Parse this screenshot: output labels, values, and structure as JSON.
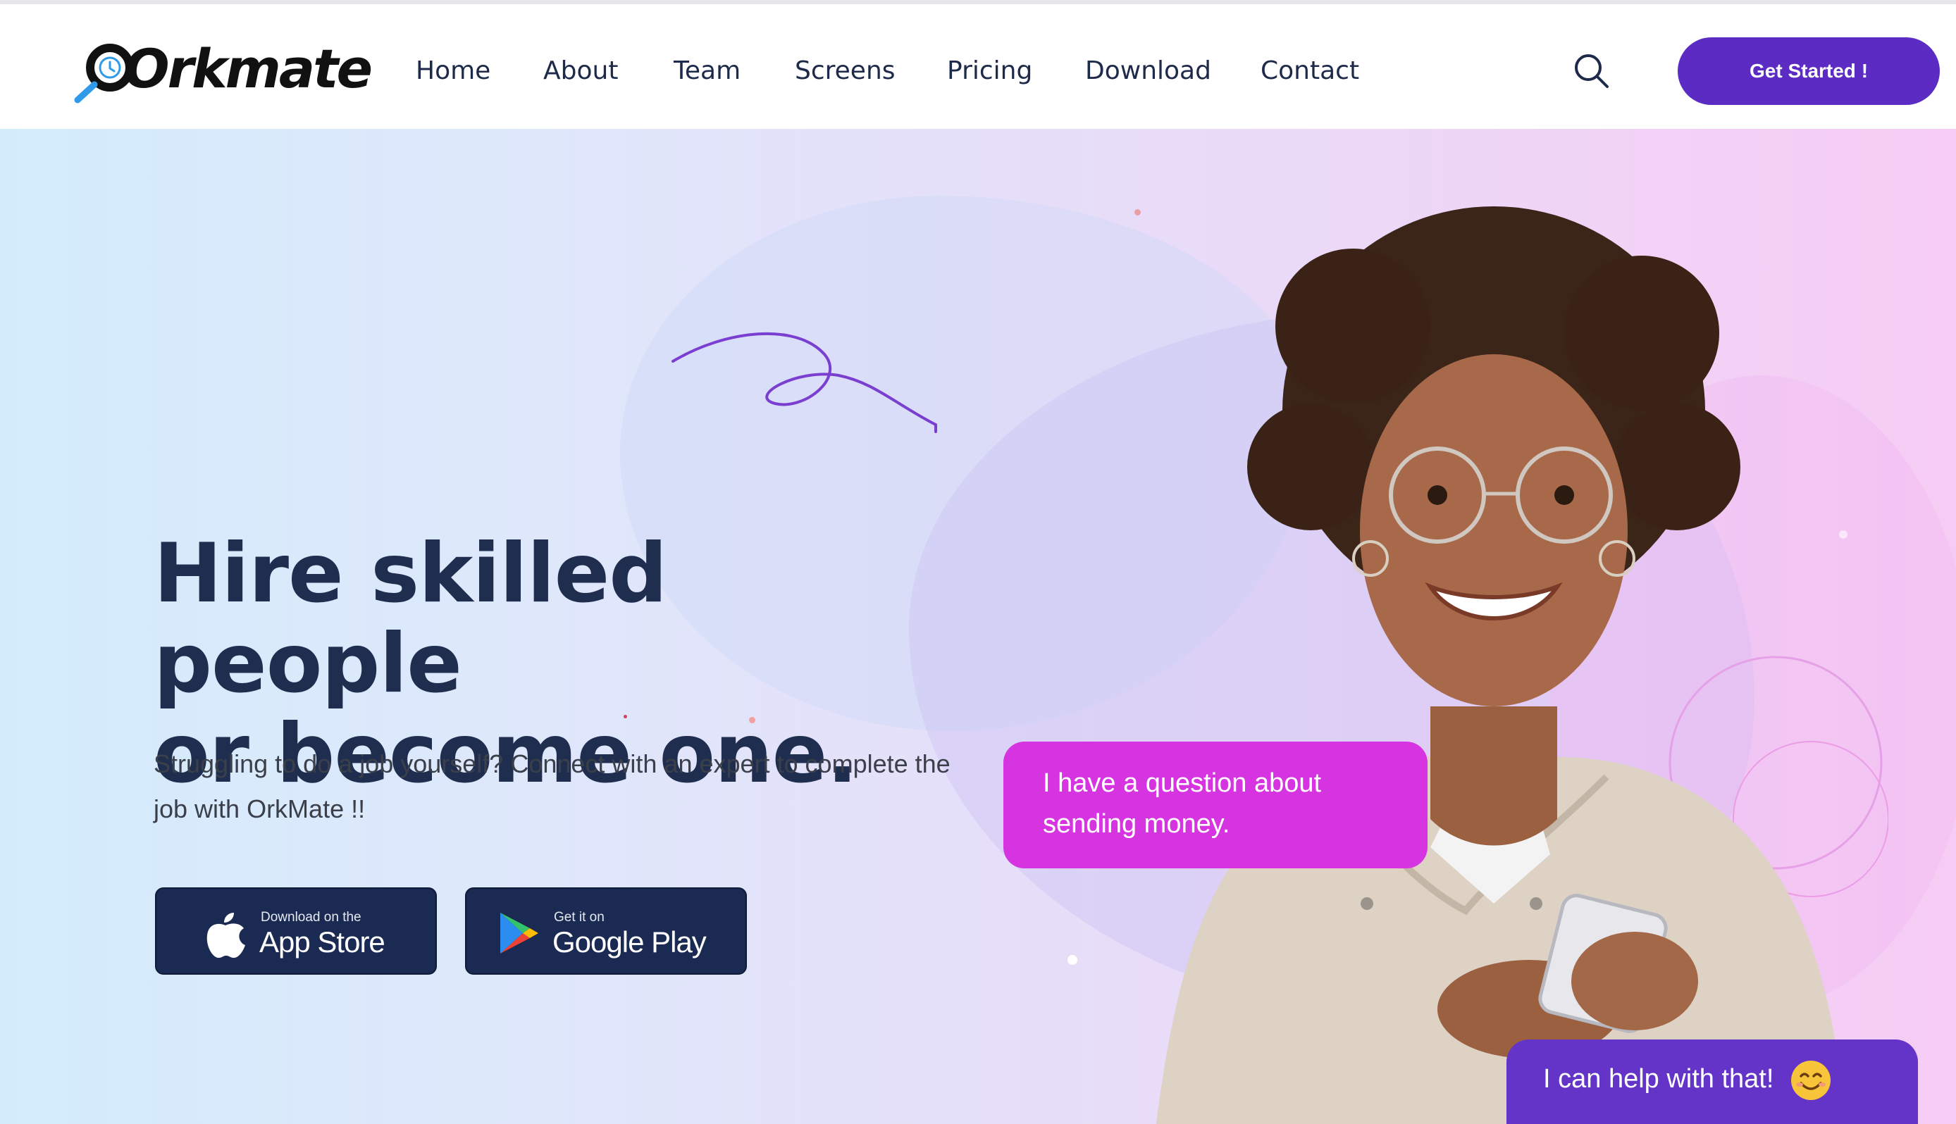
{
  "brand": {
    "logo_text": "Orkmate",
    "accent_color": "#5b2bc4"
  },
  "nav": {
    "items": [
      {
        "label": "Home"
      },
      {
        "label": "About"
      },
      {
        "label": "Team"
      },
      {
        "label": "Screens"
      },
      {
        "label": "Pricing"
      },
      {
        "label": "Download"
      },
      {
        "label": "Contact"
      }
    ],
    "search_icon": "search-icon",
    "cta_label": "Get Started !"
  },
  "hero": {
    "headline_line1": "Hire skilled people",
    "headline_line2": "or become one.",
    "subtext": "Struggling to do a job yourself? Connect with an expert to complete the job with OrkMate !!",
    "app_store": {
      "small": "Download on the",
      "big": "App Store",
      "icon": "apple-icon"
    },
    "google_play": {
      "small": "Get it on",
      "big": "Google Play",
      "icon": "google-play-icon"
    },
    "chat_question": "I have a question about sending money.",
    "chat_answer": "I can help with that!",
    "answer_emoji": "smiling-face-icon"
  }
}
